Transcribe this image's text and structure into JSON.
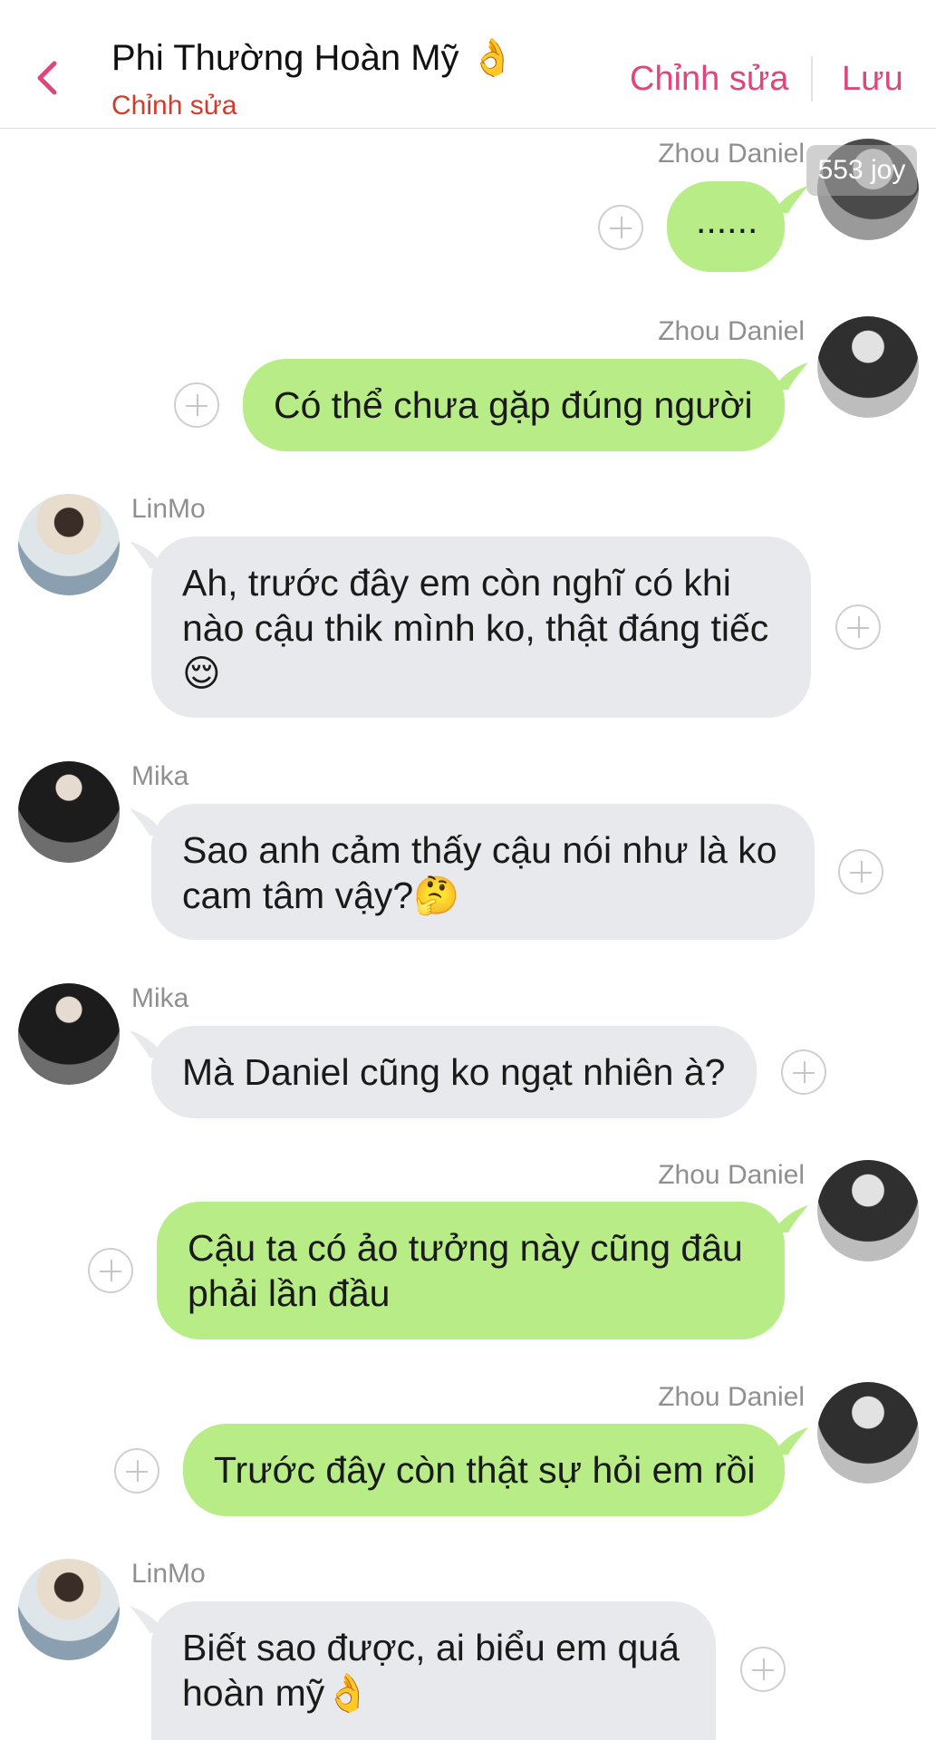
{
  "header": {
    "title": "Phi Thường Hoàn Mỹ",
    "title_emoji": "👌",
    "subtitle": "Chỉnh sửa",
    "edit_label": "Chỉnh sửa",
    "save_label": "Lưu"
  },
  "badge": "553 joy",
  "messages": [
    {
      "sender": "Zhou Daniel",
      "side": "right",
      "text": "......"
    },
    {
      "sender": "Zhou Daniel",
      "side": "right",
      "text": "Có thể chưa gặp đúng người"
    },
    {
      "sender": "LinMo",
      "side": "left",
      "text": "Ah, trước đây em còn nghĩ có khi\nnào cậu thik mình ko, thật đáng tiếc\n😌"
    },
    {
      "sender": "Mika",
      "side": "left",
      "text": "Sao anh cảm thấy cậu nói như là ko\ncam tâm vậy?🤔"
    },
    {
      "sender": "Mika",
      "side": "left",
      "text": "Mà Daniel cũng ko ngạt nhiên à?"
    },
    {
      "sender": "Zhou Daniel",
      "side": "right",
      "text": "Cậu ta có ảo tưởng này cũng đâu\nphải lần đầu"
    },
    {
      "sender": "Zhou Daniel",
      "side": "right",
      "text": "Trước đây còn thật sự hỏi em rồi"
    },
    {
      "sender": "LinMo",
      "side": "left",
      "text": "Biết sao được, ai biểu em quá\nhoàn mỹ👌"
    }
  ],
  "colors": {
    "accent": "#e0457b",
    "subtitle": "#d63a2a",
    "mine_bubble": "#b7ec86",
    "their_bubble": "#e7e9ec"
  }
}
